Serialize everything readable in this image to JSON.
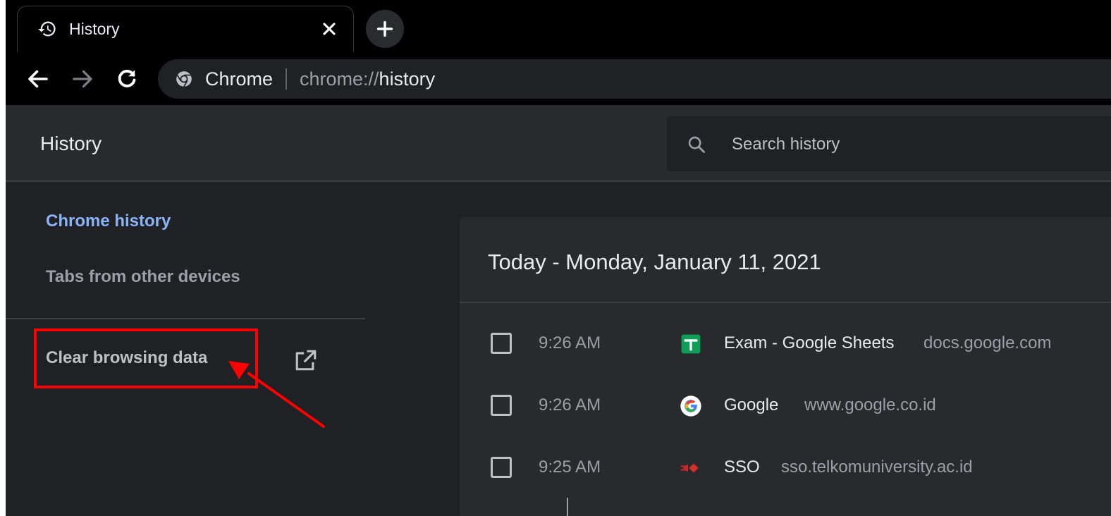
{
  "tab": {
    "title": "History"
  },
  "omnibox": {
    "label": "Chrome",
    "url_prefix": "chrome://",
    "url_highlight": "history"
  },
  "header": {
    "title": "History",
    "search_placeholder": "Search history"
  },
  "sidebar": {
    "items": [
      {
        "label": "Chrome history",
        "active": true
      },
      {
        "label": "Tabs from other devices",
        "active": false
      }
    ],
    "clear_label": "Clear browsing data"
  },
  "history": {
    "day_title": "Today - Monday, January 11, 2021",
    "entries": [
      {
        "time": "9:26 AM",
        "title": "Exam - Google Sheets",
        "domain": "docs.google.com",
        "icon": "google-sheets-icon"
      },
      {
        "time": "9:26 AM",
        "title": "Google",
        "domain": "www.google.co.id",
        "icon": "google-icon"
      },
      {
        "time": "9:25 AM",
        "title": "SSO",
        "domain": "sso.telkomuniversity.ac.id",
        "icon": "sso-icon"
      }
    ]
  },
  "colors": {
    "accent": "#8ab4f8",
    "highlight_box": "#ff0000",
    "background": "#202124",
    "surface": "#292a2d"
  }
}
